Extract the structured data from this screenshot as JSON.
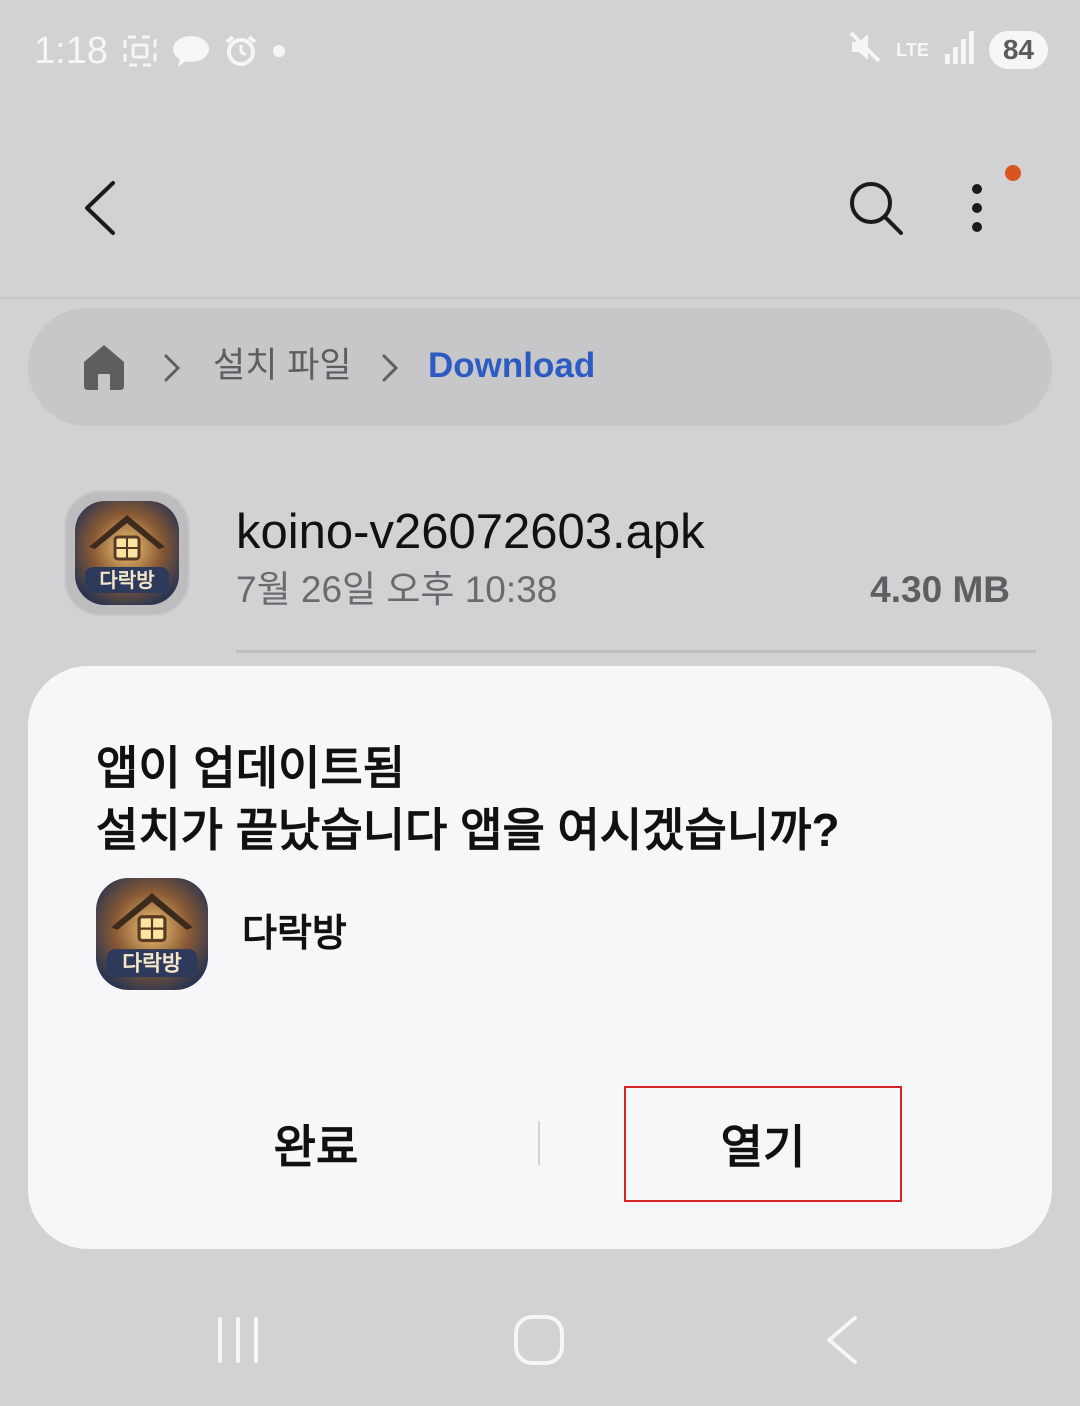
{
  "status_bar": {
    "time": "1:18",
    "network": "LTE",
    "battery": "84"
  },
  "breadcrumb": {
    "items": [
      {
        "label": "설치 파일"
      },
      {
        "label": "Download"
      }
    ]
  },
  "file": {
    "name": "koino-v26072603.apk",
    "date": "7월 26일 오후 10:38",
    "size": "4.30 MB",
    "icon_text": "다락방"
  },
  "dialog": {
    "title": "앱이 업데이트됨",
    "message": "설치가 끝났습니다 앱을 여시겠습니까?",
    "app_name": "다락방",
    "done_label": "완료",
    "open_label": "열기"
  },
  "colors": {
    "accent": "#2d5bc4",
    "notification_dot": "#d9541e",
    "highlight_border": "#d42525"
  }
}
